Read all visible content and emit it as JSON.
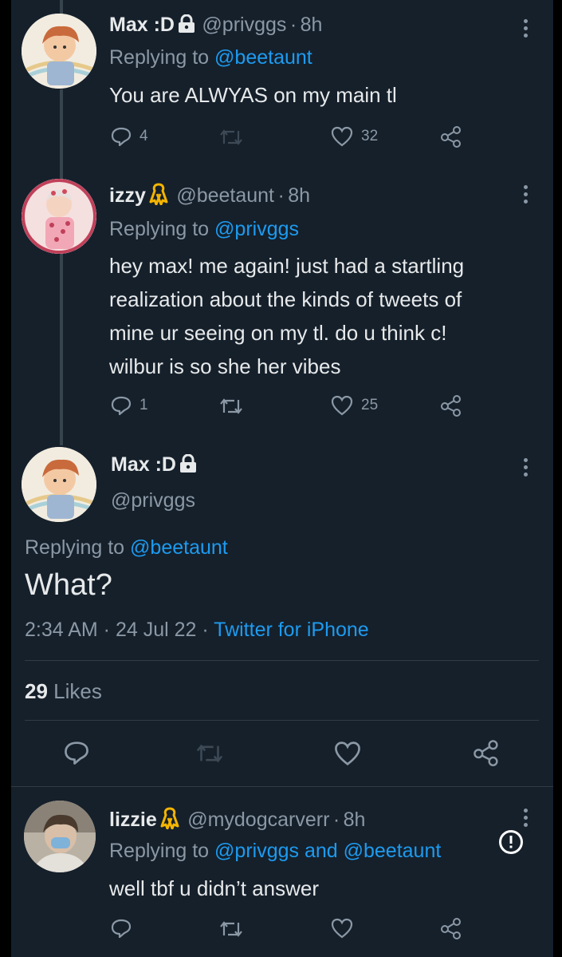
{
  "tweets": [
    {
      "name": "Max :D",
      "handle": "@privggs",
      "time": "8h",
      "replying_prefix": "Replying to",
      "replying_to": "@beetaunt",
      "text": "You are ALWYAS on my main tl",
      "replies": "4",
      "likes": "32"
    },
    {
      "name": "izzy",
      "handle": "@beetaunt",
      "time": "8h",
      "replying_prefix": "Replying to",
      "replying_to": "@privggs",
      "text_lines": [
        "hey max! me again! just had a startling",
        "realization about the kinds of tweets of",
        "mine ur seeing on my tl. do u think c!",
        "wilbur is so she her vibes"
      ],
      "replies": "1",
      "likes": "25"
    }
  ],
  "main": {
    "name": "Max :D",
    "handle": "@privggs",
    "replying_prefix": "Replying to",
    "replying_to": "@beetaunt",
    "text": "What?",
    "timestamp": "2:34 AM · 24 Jul 22 · ",
    "source": "Twitter for iPhone",
    "likes_count": "29",
    "likes_label": "Likes"
  },
  "reply": {
    "name": "lizzie",
    "handle": "@mydogcarverr",
    "time": "8h",
    "replying_prefix": "Replying to",
    "replying_to": "@privggs and @beetaunt",
    "text": "well tbf u didn’t answer"
  },
  "colors": {
    "background": "#15202b",
    "accent": "#1d9bf0",
    "muted": "#8b98a5",
    "ribbon": "#f4b400"
  }
}
